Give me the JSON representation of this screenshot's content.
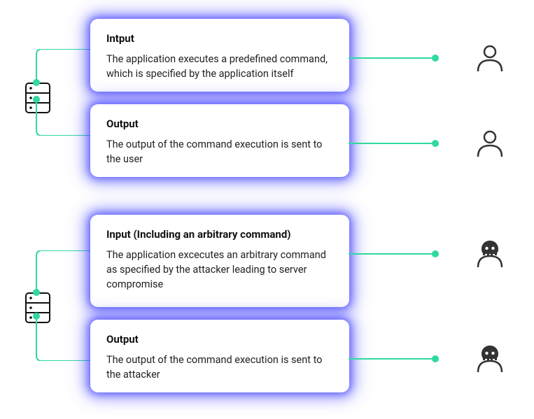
{
  "section1": {
    "card1": {
      "title": "Intput",
      "body": "The application executes a predefined command, which is specified by the application itself"
    },
    "card2": {
      "title": "Output",
      "body": "The output of the command execution is sent to the user"
    },
    "serverIcon": "server-icon",
    "userIcon": "user-icon"
  },
  "section2": {
    "card1": {
      "title": "Input (Including an arbitrary command)",
      "body": "The application excecutes an arbitrary command as specified by the attacker leading to server compromise"
    },
    "card2": {
      "title": "Output",
      "body": "The output of the command execution is sent to the attacker"
    },
    "serverIcon": "server-icon",
    "attackerIcon": "attacker-icon"
  }
}
